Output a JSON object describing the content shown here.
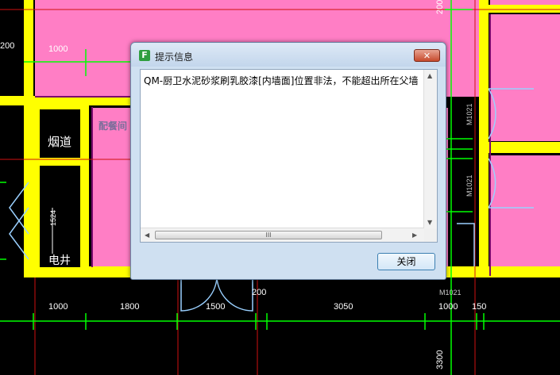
{
  "dialog": {
    "title": "提示信息",
    "app_icon_glyph": "F",
    "close_glyph": "✕",
    "message": "QM-厨卫水泥砂浆刷乳胶漆[内墙面]位置非法，不能超出所在父墙面",
    "close_button": "关闭",
    "hscroll_grip": "III"
  },
  "cad": {
    "room_labels": {
      "flue": "烟道",
      "elevator_shaft": "电井",
      "pantry": "配餐间"
    },
    "dims_top": {
      "left": "200",
      "mid": "1000",
      "right_vertical": "200"
    },
    "dims_bottom": [
      "1000",
      "1800",
      "1500",
      "200",
      "3050",
      "1000",
      "150"
    ],
    "door_tags": {
      "right_upper": "M1021",
      "right_lower": "M1021",
      "bottom_right": "M1021"
    },
    "shaft_dim": "1524",
    "bottom_vertical_dim": "3300"
  },
  "colors": {
    "room_fill": "#ff7ec5",
    "wall_yellow": "#ffff00",
    "wall_purple": "#7a0a6e",
    "grid_green": "#00ff00",
    "axis_red": "#d01010"
  }
}
